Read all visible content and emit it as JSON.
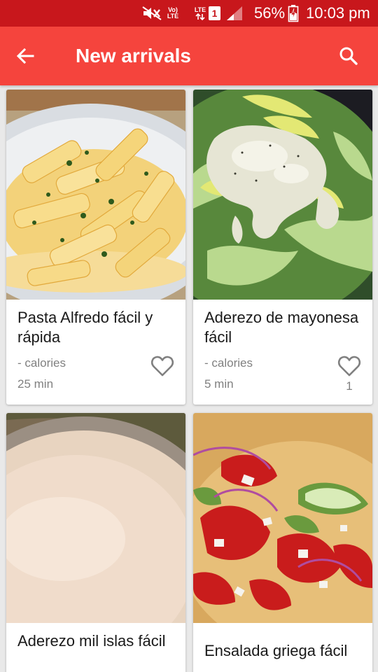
{
  "status_bar": {
    "volte": "Vo)\nLTE",
    "lte": "LTE",
    "sim": "1",
    "battery": "56%",
    "time": "10:03 pm"
  },
  "app_bar": {
    "title": "New arrivals",
    "back_icon": "arrow-back-icon",
    "search_icon": "search-icon"
  },
  "recipes": [
    {
      "name": "Pasta Alfredo fácil y rápida",
      "calories": "- calories",
      "time": "25 min",
      "likes": ""
    },
    {
      "name": "Aderezo de mayonesa fácil",
      "calories": "- calories",
      "time": "5 min",
      "likes": "1"
    },
    {
      "name": "Aderezo mil islas fácil",
      "calories": "",
      "time": "",
      "likes": ""
    },
    {
      "name": "Ensalada griega fácil",
      "calories": "",
      "time": "",
      "likes": ""
    }
  ],
  "colors": {
    "status_bar": "#c8171c",
    "app_bar": "#f5443d",
    "background": "#e9e9e9",
    "secondary_text": "#808080"
  }
}
